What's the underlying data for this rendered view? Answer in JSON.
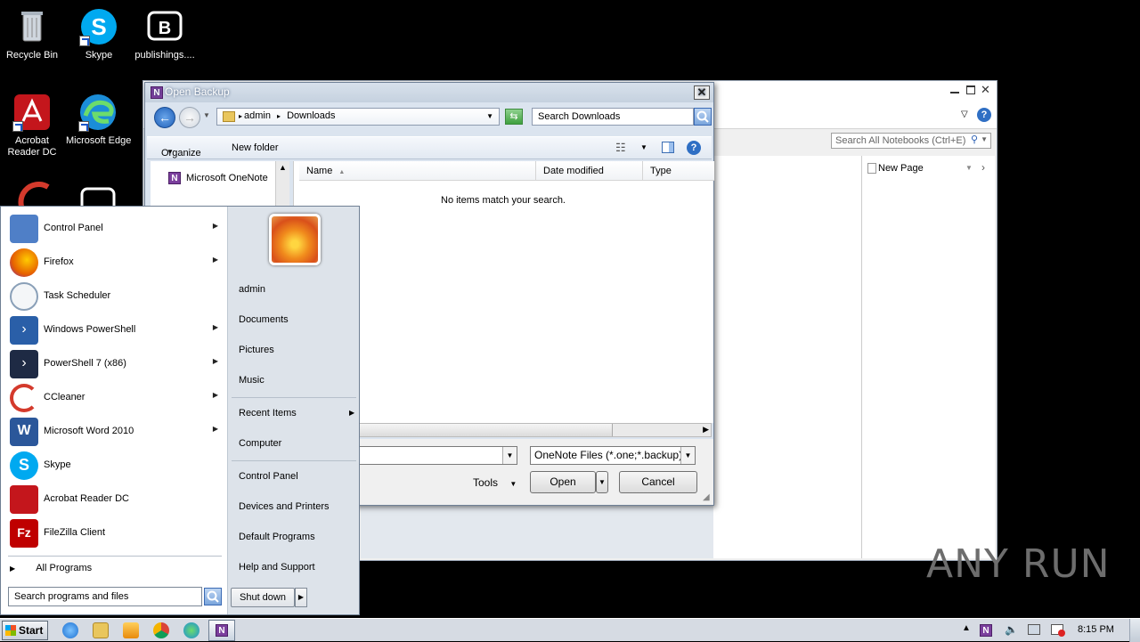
{
  "desktop": {
    "icons": [
      {
        "label": "Recycle Bin",
        "icon": "recycle-bin-icon"
      },
      {
        "label": "Skype",
        "icon": "skype-icon"
      },
      {
        "label": "publishings....",
        "icon": "publishings-icon"
      },
      {
        "label": "Acrobat\nReader DC",
        "icon": "acrobat-icon"
      },
      {
        "label": "Microsoft Edge",
        "icon": "edge-icon"
      }
    ]
  },
  "onenote": {
    "search_placeholder": "Search All Notebooks (Ctrl+E)",
    "new_page": "New Page"
  },
  "dialog": {
    "title": "Open Backup",
    "breadcrumb": [
      "admin",
      "Downloads"
    ],
    "search_placeholder": "Search Downloads",
    "toolbar": {
      "organize": "Organize",
      "new_folder": "New folder"
    },
    "nav_item": "Microsoft OneNote",
    "columns": [
      "Name",
      "Date modified",
      "Type"
    ],
    "empty_message": "No items match your search.",
    "filter": "OneNote Files (*.one;*.backup)",
    "tools": "Tools",
    "open": "Open",
    "cancel": "Cancel"
  },
  "startmenu": {
    "programs": [
      {
        "label": "Control Panel",
        "arrow": true,
        "color": "#4f7fc7"
      },
      {
        "label": "Firefox",
        "arrow": true,
        "color": "#e66000"
      },
      {
        "label": "Task Scheduler",
        "arrow": false,
        "color": "#8aa0b8"
      },
      {
        "label": "Windows PowerShell",
        "arrow": true,
        "color": "#2a5fa8"
      },
      {
        "label": "PowerShell 7 (x86)",
        "arrow": true,
        "color": "#1e2a44"
      },
      {
        "label": "CCleaner",
        "arrow": true,
        "color": "#d43a2c"
      },
      {
        "label": "Microsoft Word 2010",
        "arrow": true,
        "color": "#2b579a"
      },
      {
        "label": "Skype",
        "arrow": false,
        "color": "#00a9f0"
      },
      {
        "label": "Acrobat Reader DC",
        "arrow": false,
        "color": "#c4161c"
      },
      {
        "label": "FileZilla Client",
        "arrow": false,
        "color": "#bf0000"
      }
    ],
    "all_programs": "All Programs",
    "search_placeholder": "Search programs and files",
    "user": "admin",
    "right_items": [
      "Documents",
      "Pictures",
      "Music",
      "Recent Items",
      "Computer",
      "Control Panel",
      "Devices and Printers",
      "Default Programs",
      "Help and Support"
    ],
    "shutdown": "Shut down"
  },
  "taskbar": {
    "start": "Start",
    "time": "8:15 PM"
  },
  "watermark": "ANY RUN"
}
